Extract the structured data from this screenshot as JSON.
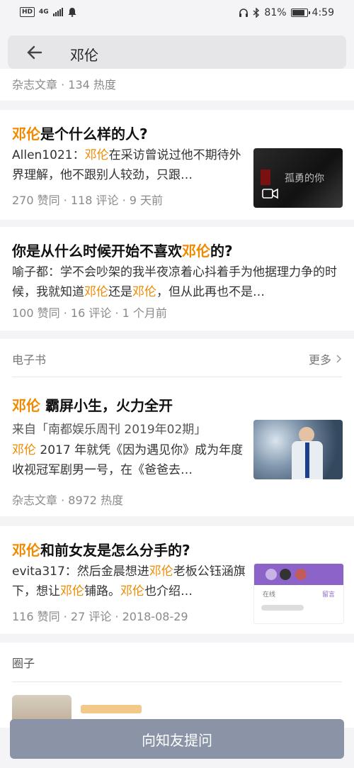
{
  "status": {
    "network_badge": "HD",
    "network_type": "4G",
    "battery_pct": "81%",
    "battery_level": 0.81,
    "time": "4:59"
  },
  "search": {
    "query": "邓伦"
  },
  "results": {
    "top_meta": "杂志文章 · 134 热度",
    "q1": {
      "title_hl": "邓伦",
      "title_rest": "是个什么样的人?",
      "author": "Allen1021：",
      "excerpt_hl": "邓伦",
      "excerpt_rest": "在采访曾说过他不期待外界理解，他不跟别人较劲，只跟…",
      "meta": "270 赞同 · 118 评论 · 9 天前",
      "thumb_text": "孤勇的你"
    },
    "q2": {
      "title_pre": "你是从什么时候开始不喜欢",
      "title_hl": "邓伦",
      "title_post": "的?",
      "excerpt_a": "喻子都：学不会吵架的我半夜凉着心抖着手为他据理力争的时候，我就知道",
      "excerpt_hl1": "邓伦",
      "excerpt_b": "还是",
      "excerpt_hl2": "邓伦",
      "excerpt_c": "，但从此再也不是…",
      "meta": "100 赞同 · 16 评论 · 1 个月前"
    },
    "ebook_section": {
      "label": "电子书",
      "more": "更多"
    },
    "ebook": {
      "title_hl": "邓伦",
      "title_rest": " 霸屏小生，火力全开",
      "source": "来自「南都娱乐周刊 2019年02期」",
      "excerpt_hl": "邓伦",
      "excerpt_rest": " 2017 年就凭《因为遇见你》成为年度收视冠军剧男一号，在《爸爸去…",
      "meta": "杂志文章 · 8972 热度"
    },
    "q3": {
      "title_hl": "邓伦",
      "title_rest": "和前女友是怎么分手的?",
      "author": "evita317：然后金晨想进",
      "hl1": "邓伦",
      "mid1": "老板公钰涵旗下，想让",
      "hl2": "邓伦",
      "mid2": "铺路。",
      "hl3": "邓伦",
      "end": "也介绍…",
      "meta": "116 赞同 · 27 评论 · 2018-08-29",
      "thumb_tab1": "在线",
      "thumb_tab2": "留言"
    },
    "circle_section": {
      "label": "圈子"
    }
  },
  "ask_button": "向知友提问",
  "colors": {
    "highlight": "#f08a00",
    "button": "#8a94a6"
  }
}
